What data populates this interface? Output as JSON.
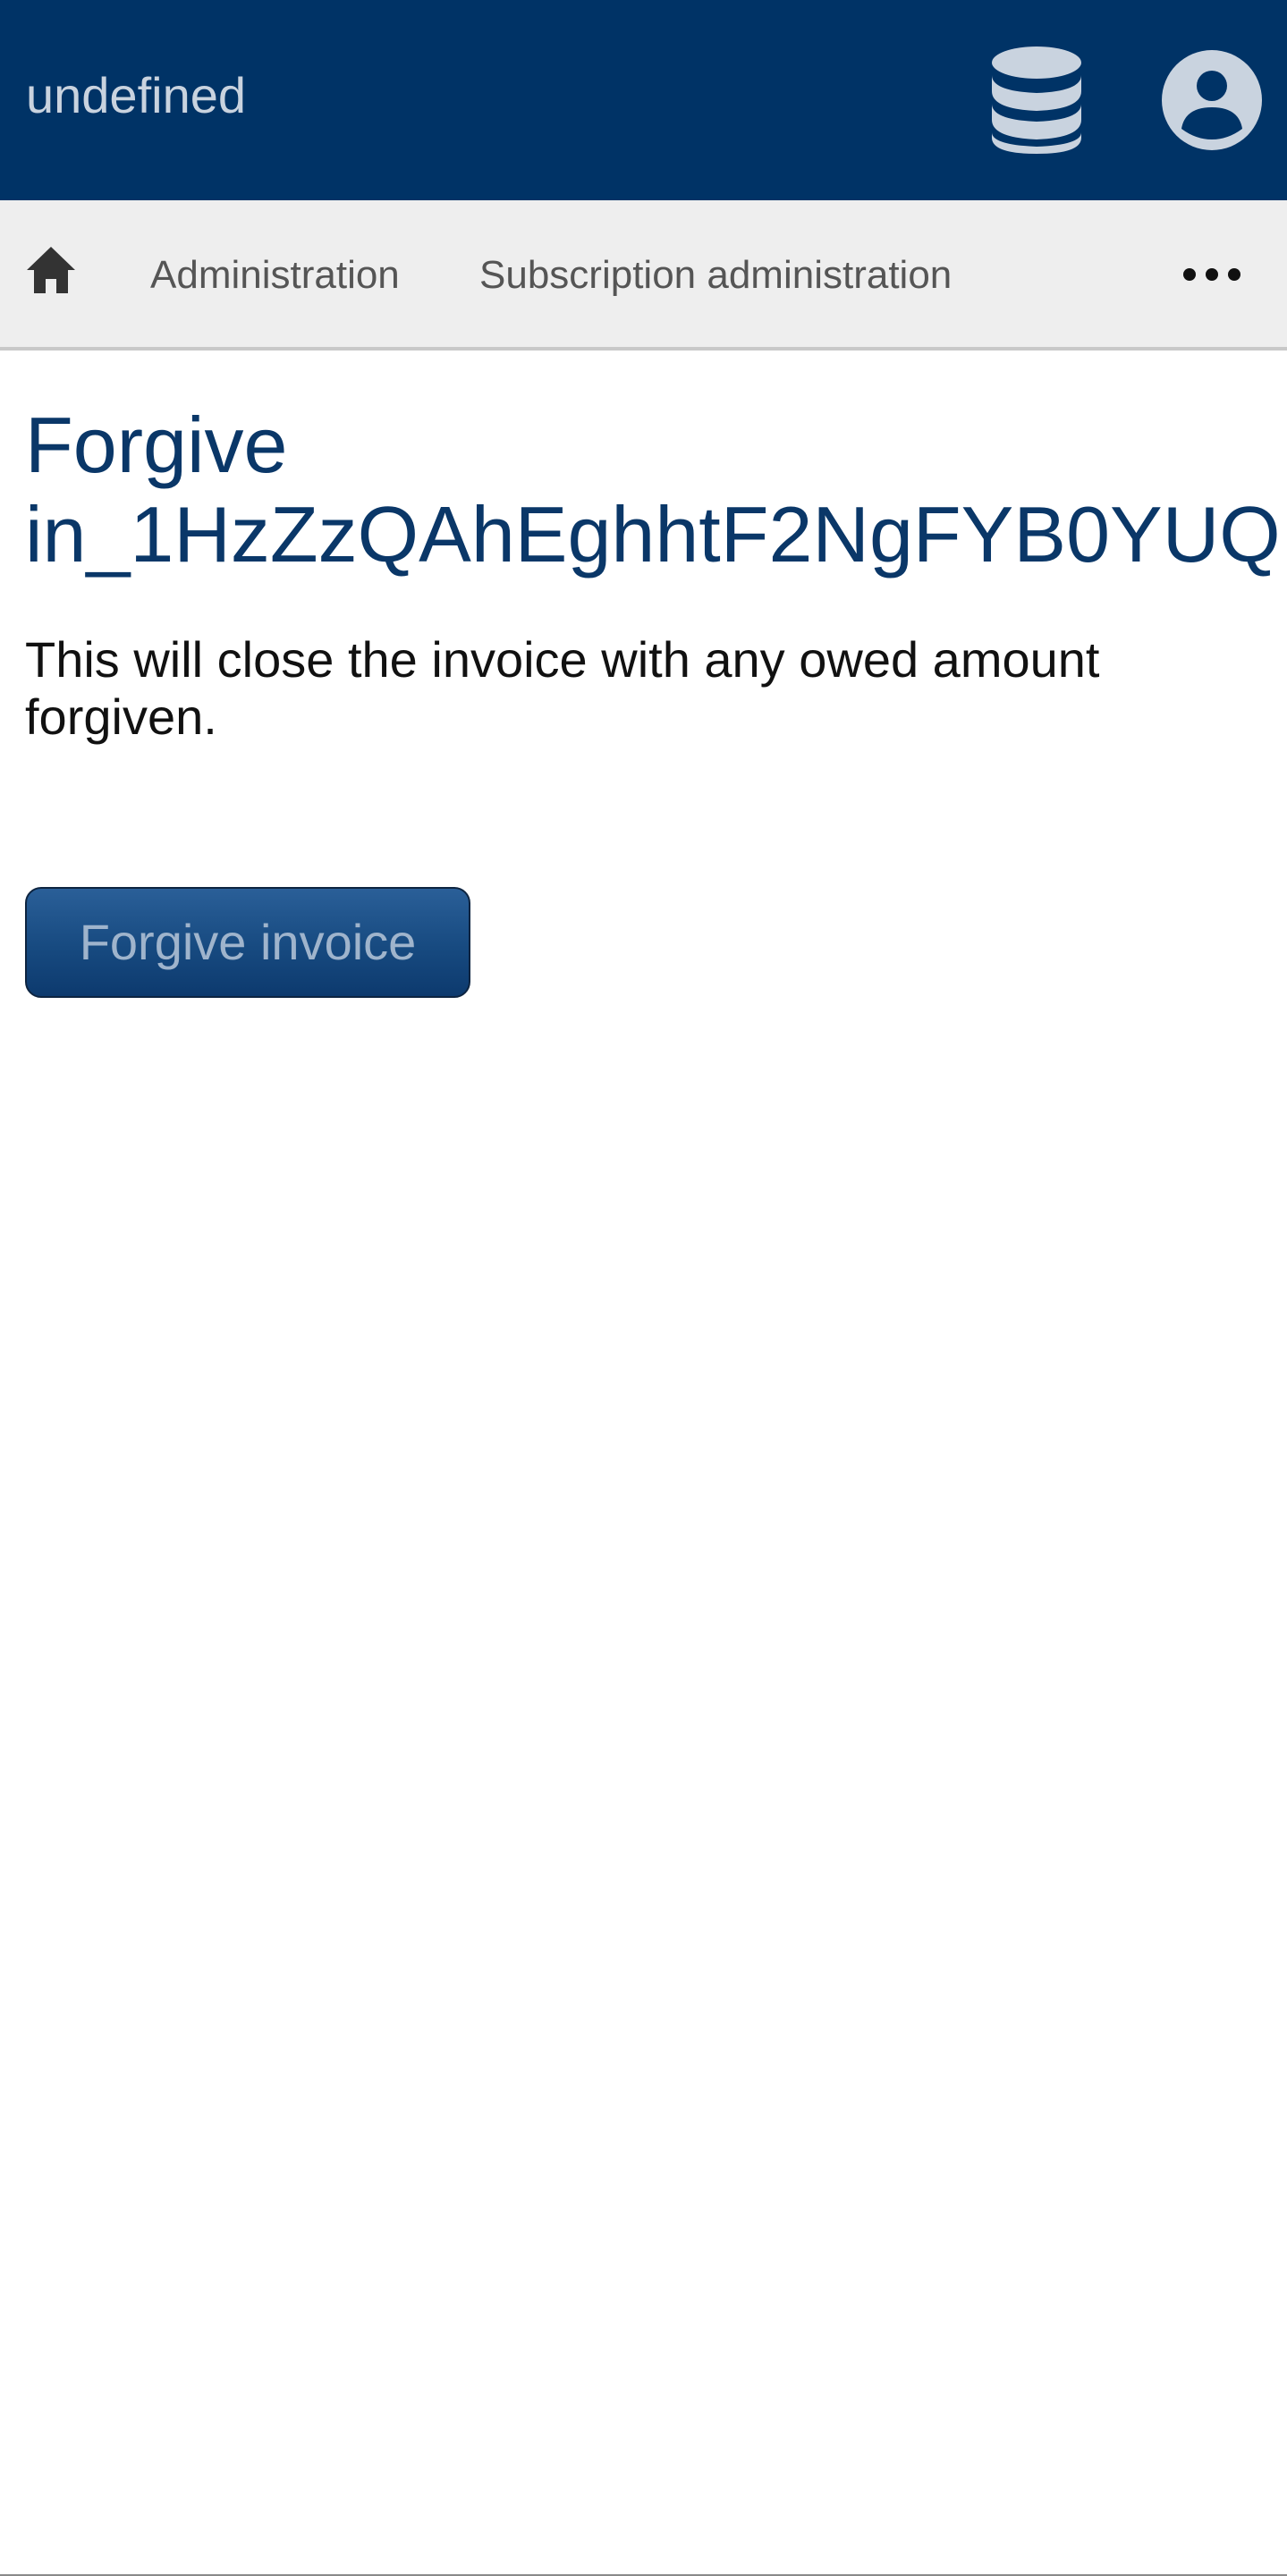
{
  "header": {
    "app_title": "undefined",
    "db_icon": "database-icon",
    "account_icon": "user-circle-icon",
    "colors": {
      "background": "#003366",
      "icon": "#c9d3df"
    }
  },
  "nav": {
    "home_icon": "home-icon",
    "items": [
      {
        "label": "Administration"
      },
      {
        "label": "Subscription administration"
      }
    ],
    "more_icon": "ellipsis-icon"
  },
  "main": {
    "title_line1": "Forgive",
    "title_line2": "in_1HzZzQAhEghhtF2NgFYB0YUQ",
    "description": "This will close the invoice with any owed amount forgiven.",
    "action_label": "Forgive invoice",
    "colors": {
      "title": "#0a3768",
      "button": "#174a80"
    }
  }
}
